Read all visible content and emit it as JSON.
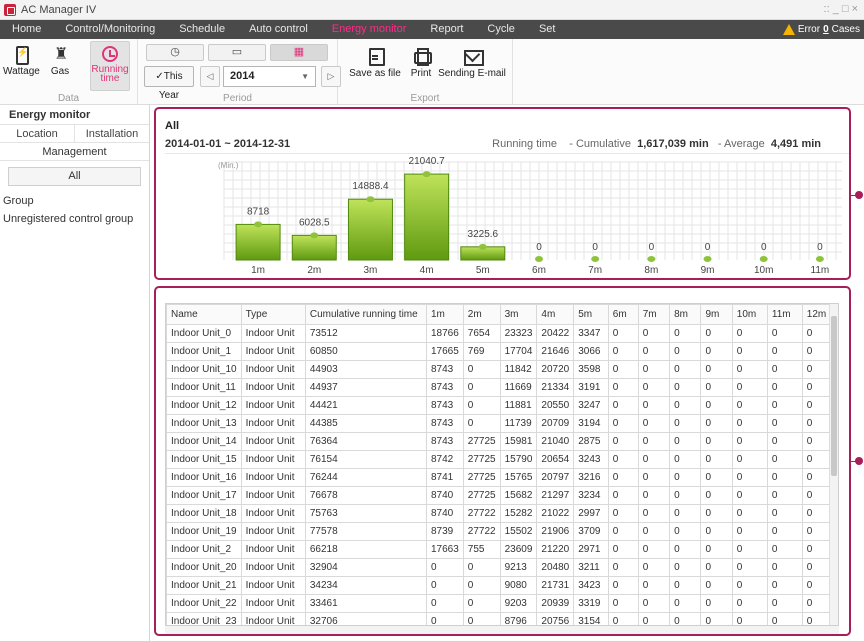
{
  "window": {
    "title": "AC Manager IV",
    "controls": "::  _  □  ×"
  },
  "menu": {
    "items": [
      {
        "label": "Home",
        "active": false
      },
      {
        "label": "Control/Monitoring",
        "active": false
      },
      {
        "label": "Schedule",
        "active": false
      },
      {
        "label": "Auto control",
        "active": false
      },
      {
        "label": "Energy monitor",
        "active": true
      },
      {
        "label": "Report",
        "active": false
      },
      {
        "label": "Cycle",
        "active": false
      },
      {
        "label": "Set",
        "active": false
      }
    ],
    "error_label": "Error",
    "error_count": "0",
    "error_suffix": "Cases"
  },
  "toolbar": {
    "data_group": {
      "label": "Data",
      "wattage": "Wattage",
      "gas": "Gas",
      "running_line1": "Running",
      "running_line2": "time"
    },
    "period_group": {
      "label": "Period",
      "this_year": "This Year",
      "checkmark": "✓",
      "year": "2014",
      "prev": "◁",
      "next": "▷",
      "caret": "▼"
    },
    "export_group": {
      "label": "Export",
      "save": "Save as file",
      "print": "Print",
      "email": "Sending E-mail"
    }
  },
  "left": {
    "title": "Energy monitor",
    "tabs": [
      "Location",
      "Installation"
    ],
    "management": "Management",
    "all": "All",
    "groups": [
      "Group",
      "Unregistered control group"
    ]
  },
  "summary": {
    "scope": "All",
    "range": "2014-01-01 ~ 2014-12-31",
    "metric": "Running time",
    "cumulative_label": "- Cumulative",
    "cumulative_value": "1,617,039 min",
    "average_label": "- Average",
    "average_value": "4,491 min"
  },
  "chart_data": {
    "type": "bar",
    "ylabel": "(Min.)",
    "categories": [
      "1m",
      "2m",
      "3m",
      "4m",
      "5m",
      "6m",
      "7m",
      "8m",
      "9m",
      "10m",
      "11m"
    ],
    "values": [
      8718,
      6028.5,
      14888.4,
      21040.7,
      3225.6,
      0,
      0,
      0,
      0,
      0,
      0
    ],
    "ylim": [
      0,
      24000
    ],
    "grid": true,
    "colors": {
      "bar_top": "#bfe35a",
      "bar_bottom": "#5f9a10",
      "grid": "#e6e6e6"
    }
  },
  "table": {
    "columns": [
      "Name",
      "Type",
      "Cumulative running time",
      "1m",
      "2m",
      "3m",
      "4m",
      "5m",
      "6m",
      "7m",
      "8m",
      "9m",
      "10m",
      "11m",
      "12m"
    ],
    "rows": [
      [
        "Indoor Unit_0",
        "Indoor Unit",
        "73512",
        "18766",
        "7654",
        "23323",
        "20422",
        "3347",
        "0",
        "0",
        "0",
        "0",
        "0",
        "0",
        "0"
      ],
      [
        "Indoor Unit_1",
        "Indoor Unit",
        "60850",
        "17665",
        "769",
        "17704",
        "21646",
        "3066",
        "0",
        "0",
        "0",
        "0",
        "0",
        "0",
        "0"
      ],
      [
        "Indoor Unit_10",
        "Indoor Unit",
        "44903",
        "8743",
        "0",
        "11842",
        "20720",
        "3598",
        "0",
        "0",
        "0",
        "0",
        "0",
        "0",
        "0"
      ],
      [
        "Indoor Unit_11",
        "Indoor Unit",
        "44937",
        "8743",
        "0",
        "11669",
        "21334",
        "3191",
        "0",
        "0",
        "0",
        "0",
        "0",
        "0",
        "0"
      ],
      [
        "Indoor Unit_12",
        "Indoor Unit",
        "44421",
        "8743",
        "0",
        "11881",
        "20550",
        "3247",
        "0",
        "0",
        "0",
        "0",
        "0",
        "0",
        "0"
      ],
      [
        "Indoor Unit_13",
        "Indoor Unit",
        "44385",
        "8743",
        "0",
        "11739",
        "20709",
        "3194",
        "0",
        "0",
        "0",
        "0",
        "0",
        "0",
        "0"
      ],
      [
        "Indoor Unit_14",
        "Indoor Unit",
        "76364",
        "8743",
        "27725",
        "15981",
        "21040",
        "2875",
        "0",
        "0",
        "0",
        "0",
        "0",
        "0",
        "0"
      ],
      [
        "Indoor Unit_15",
        "Indoor Unit",
        "76154",
        "8742",
        "27725",
        "15790",
        "20654",
        "3243",
        "0",
        "0",
        "0",
        "0",
        "0",
        "0",
        "0"
      ],
      [
        "Indoor Unit_16",
        "Indoor Unit",
        "76244",
        "8741",
        "27725",
        "15765",
        "20797",
        "3216",
        "0",
        "0",
        "0",
        "0",
        "0",
        "0",
        "0"
      ],
      [
        "Indoor Unit_17",
        "Indoor Unit",
        "76678",
        "8740",
        "27725",
        "15682",
        "21297",
        "3234",
        "0",
        "0",
        "0",
        "0",
        "0",
        "0",
        "0"
      ],
      [
        "Indoor Unit_18",
        "Indoor Unit",
        "75763",
        "8740",
        "27722",
        "15282",
        "21022",
        "2997",
        "0",
        "0",
        "0",
        "0",
        "0",
        "0",
        "0"
      ],
      [
        "Indoor Unit_19",
        "Indoor Unit",
        "77578",
        "8739",
        "27722",
        "15502",
        "21906",
        "3709",
        "0",
        "0",
        "0",
        "0",
        "0",
        "0",
        "0"
      ],
      [
        "Indoor Unit_2",
        "Indoor Unit",
        "66218",
        "17663",
        "755",
        "23609",
        "21220",
        "2971",
        "0",
        "0",
        "0",
        "0",
        "0",
        "0",
        "0"
      ],
      [
        "Indoor Unit_20",
        "Indoor Unit",
        "32904",
        "0",
        "0",
        "9213",
        "20480",
        "3211",
        "0",
        "0",
        "0",
        "0",
        "0",
        "0",
        "0"
      ],
      [
        "Indoor Unit_21",
        "Indoor Unit",
        "34234",
        "0",
        "0",
        "9080",
        "21731",
        "3423",
        "0",
        "0",
        "0",
        "0",
        "0",
        "0",
        "0"
      ],
      [
        "Indoor Unit_22",
        "Indoor Unit",
        "33461",
        "0",
        "0",
        "9203",
        "20939",
        "3319",
        "0",
        "0",
        "0",
        "0",
        "0",
        "0",
        "0"
      ],
      [
        "Indoor Unit_23",
        "Indoor Unit",
        "32706",
        "0",
        "0",
        "8796",
        "20756",
        "3154",
        "0",
        "0",
        "0",
        "0",
        "0",
        "0",
        "0"
      ]
    ]
  },
  "colors": {
    "accent": "#a61e5a",
    "active_menu": "#ff2a8a",
    "menubar": "#4a4a4a"
  }
}
